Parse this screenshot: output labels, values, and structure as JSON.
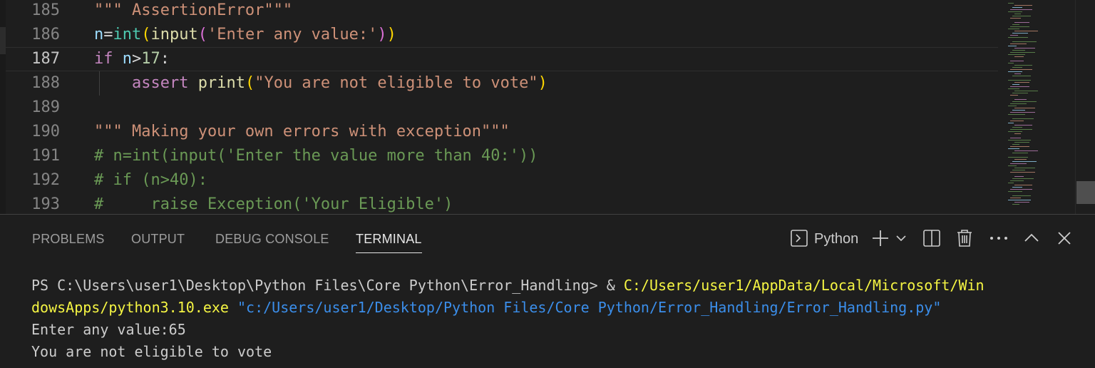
{
  "editor": {
    "current_line": "187",
    "lines": [
      {
        "num": "185",
        "tokens": [
          {
            "t": "\"\"\" AssertionError\"\"\"",
            "c": "t-str"
          }
        ]
      },
      {
        "num": "186",
        "tokens": [
          {
            "t": "n",
            "c": "t-var"
          },
          {
            "t": "=",
            "c": "t-op"
          },
          {
            "t": "int",
            "c": "t-type"
          },
          {
            "t": "(",
            "c": "t-paren1"
          },
          {
            "t": "input",
            "c": "t-fn"
          },
          {
            "t": "(",
            "c": "t-paren2"
          },
          {
            "t": "'Enter any value:'",
            "c": "t-str"
          },
          {
            "t": ")",
            "c": "t-paren2"
          },
          {
            "t": ")",
            "c": "t-paren1"
          }
        ]
      },
      {
        "num": "187",
        "tokens": [
          {
            "t": "if",
            "c": "t-kw"
          },
          {
            "t": " ",
            "c": "t-op"
          },
          {
            "t": "n",
            "c": "t-var"
          },
          {
            "t": ">",
            "c": "t-op"
          },
          {
            "t": "17",
            "c": "t-num"
          },
          {
            "t": ":",
            "c": "t-op"
          }
        ]
      },
      {
        "num": "188",
        "tokens": [
          {
            "t": "    ",
            "c": "t-op"
          },
          {
            "t": "assert",
            "c": "t-kw"
          },
          {
            "t": " ",
            "c": "t-op"
          },
          {
            "t": "print",
            "c": "t-fn"
          },
          {
            "t": "(",
            "c": "t-paren1"
          },
          {
            "t": "\"You are not eligible to vote\"",
            "c": "t-str"
          },
          {
            "t": ")",
            "c": "t-paren1"
          }
        ]
      },
      {
        "num": "189",
        "tokens": []
      },
      {
        "num": "190",
        "tokens": [
          {
            "t": "\"\"\" Making your own errors with exception\"\"\"",
            "c": "t-str"
          }
        ]
      },
      {
        "num": "191",
        "tokens": [
          {
            "t": "# n=int(input('Enter the value more than 40:'))",
            "c": "t-com"
          }
        ]
      },
      {
        "num": "192",
        "tokens": [
          {
            "t": "# if (n>40):",
            "c": "t-com"
          }
        ]
      },
      {
        "num": "193",
        "tokens": [
          {
            "t": "#     raise Exception('Your Eligible')",
            "c": "t-com"
          }
        ]
      }
    ]
  },
  "panel": {
    "tabs": [
      {
        "id": "problems",
        "label": "PROBLEMS"
      },
      {
        "id": "output",
        "label": "OUTPUT"
      },
      {
        "id": "debug-console",
        "label": "DEBUG CONSOLE"
      },
      {
        "id": "terminal",
        "label": "TERMINAL"
      }
    ],
    "active_tab": "TERMINAL",
    "terminal_profile": "Python",
    "icons": [
      "terminal-icon",
      "plus-icon",
      "chevron-down-icon",
      "split-icon",
      "trash-icon",
      "more-icon",
      "chevron-up-icon",
      "close-icon"
    ]
  },
  "terminal": {
    "lines": [
      [
        {
          "t": "PS C:\\Users\\user1\\Desktop\\Python Files\\Core Python\\Error_Handling> & ",
          "c": ""
        },
        {
          "t": "C:/Users/user1/AppData/Local/Microsoft/Win",
          "c": "term-yellow"
        }
      ],
      [
        {
          "t": "dowsApps/python3.10.exe",
          "c": "term-yellow"
        },
        {
          "t": " ",
          "c": ""
        },
        {
          "t": "\"c:/Users/user1/Desktop/Python Files/Core Python/Error_Handling/Error_Handling.py\"",
          "c": "term-cyan"
        }
      ],
      [
        {
          "t": "Enter any value:65",
          "c": ""
        }
      ],
      [
        {
          "t": "You are not eligible to vote",
          "c": ""
        }
      ]
    ]
  },
  "colors": {
    "background": "#1e1e1e",
    "string": "#ce9178",
    "keyword": "#c586c0",
    "comment": "#6a9955",
    "terminal_exe": "#f5f543",
    "terminal_path": "#3b8eea"
  }
}
